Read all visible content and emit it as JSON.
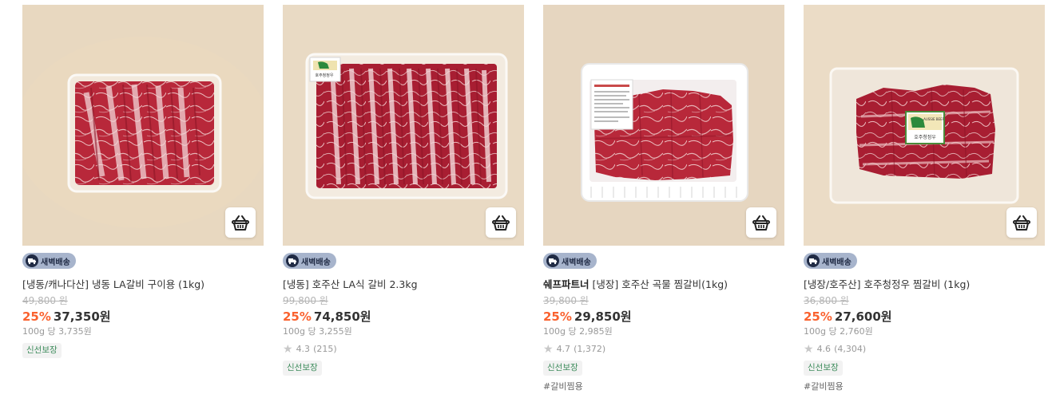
{
  "products": [
    {
      "delivery_badge": "새벽배송",
      "brand": "",
      "title": "[냉동/캐나다산] 냉동 LA갈비 구이용 (1kg)",
      "original_price": "49,800 원",
      "discount": "25%",
      "price": "37,350원",
      "unit_price": "100g 당 3,735원",
      "rating": "",
      "review_count": "",
      "fresh_badge": "신선보장",
      "hashtag": "",
      "cart_icon": "basket-icon"
    },
    {
      "delivery_badge": "새벽배송",
      "brand": "",
      "title": "[냉동] 호주산 LA식 갈비 2.3kg",
      "original_price": "99,800 원",
      "discount": "25%",
      "price": "74,850원",
      "unit_price": "100g 당 3,255원",
      "rating": "4.3",
      "review_count": "(215)",
      "fresh_badge": "신선보장",
      "hashtag": "",
      "cart_icon": "basket-icon"
    },
    {
      "delivery_badge": "새벽배송",
      "brand": "쉐프파트너",
      "title": "[냉장] 호주산 곡물 찜갈비(1kg)",
      "original_price": "39,800 원",
      "discount": "25%",
      "price": "29,850원",
      "unit_price": "100g 당 2,985원",
      "rating": "4.7",
      "review_count": "(1,372)",
      "fresh_badge": "신선보장",
      "hashtag": "#갈비찜용",
      "cart_icon": "basket-icon"
    },
    {
      "delivery_badge": "새벽배송",
      "brand": "",
      "title": "[냉장/호주산] 호주청정우 찜갈비 (1kg)",
      "original_price": "36,800 원",
      "discount": "25%",
      "price": "27,600원",
      "unit_price": "100g 당 2,760원",
      "rating": "4.6",
      "review_count": "(4,304)",
      "fresh_badge": "신선보장",
      "hashtag": "#갈비찜용",
      "cart_icon": "basket-icon"
    }
  ],
  "label_texts": {
    "aussie_beef_logo": "AUSSIE BEEF",
    "aussie_beef_label": "호주청정우"
  },
  "colors": {
    "discount": "#fa622f",
    "delivery_badge_bg": "#a7b4cc",
    "fresh_badge_text": "#3e8c5c",
    "background_beige": "#e6d5bd"
  }
}
